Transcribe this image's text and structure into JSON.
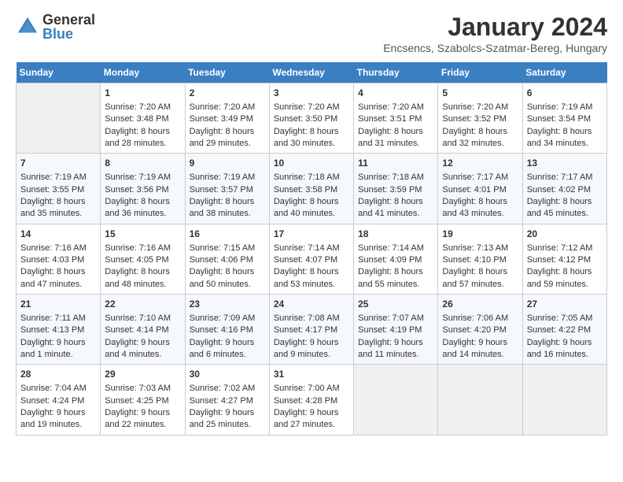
{
  "header": {
    "logo": {
      "general": "General",
      "blue": "Blue"
    },
    "title": "January 2024",
    "location": "Encsencs, Szabolcs-Szatmar-Bereg, Hungary"
  },
  "weekdays": [
    "Sunday",
    "Monday",
    "Tuesday",
    "Wednesday",
    "Thursday",
    "Friday",
    "Saturday"
  ],
  "weeks": [
    [
      {
        "day": "",
        "sunrise": "",
        "sunset": "",
        "daylight": ""
      },
      {
        "day": "1",
        "sunrise": "Sunrise: 7:20 AM",
        "sunset": "Sunset: 3:48 PM",
        "daylight": "Daylight: 8 hours and 28 minutes."
      },
      {
        "day": "2",
        "sunrise": "Sunrise: 7:20 AM",
        "sunset": "Sunset: 3:49 PM",
        "daylight": "Daylight: 8 hours and 29 minutes."
      },
      {
        "day": "3",
        "sunrise": "Sunrise: 7:20 AM",
        "sunset": "Sunset: 3:50 PM",
        "daylight": "Daylight: 8 hours and 30 minutes."
      },
      {
        "day": "4",
        "sunrise": "Sunrise: 7:20 AM",
        "sunset": "Sunset: 3:51 PM",
        "daylight": "Daylight: 8 hours and 31 minutes."
      },
      {
        "day": "5",
        "sunrise": "Sunrise: 7:20 AM",
        "sunset": "Sunset: 3:52 PM",
        "daylight": "Daylight: 8 hours and 32 minutes."
      },
      {
        "day": "6",
        "sunrise": "Sunrise: 7:19 AM",
        "sunset": "Sunset: 3:54 PM",
        "daylight": "Daylight: 8 hours and 34 minutes."
      }
    ],
    [
      {
        "day": "7",
        "sunrise": "Sunrise: 7:19 AM",
        "sunset": "Sunset: 3:55 PM",
        "daylight": "Daylight: 8 hours and 35 minutes."
      },
      {
        "day": "8",
        "sunrise": "Sunrise: 7:19 AM",
        "sunset": "Sunset: 3:56 PM",
        "daylight": "Daylight: 8 hours and 36 minutes."
      },
      {
        "day": "9",
        "sunrise": "Sunrise: 7:19 AM",
        "sunset": "Sunset: 3:57 PM",
        "daylight": "Daylight: 8 hours and 38 minutes."
      },
      {
        "day": "10",
        "sunrise": "Sunrise: 7:18 AM",
        "sunset": "Sunset: 3:58 PM",
        "daylight": "Daylight: 8 hours and 40 minutes."
      },
      {
        "day": "11",
        "sunrise": "Sunrise: 7:18 AM",
        "sunset": "Sunset: 3:59 PM",
        "daylight": "Daylight: 8 hours and 41 minutes."
      },
      {
        "day": "12",
        "sunrise": "Sunrise: 7:17 AM",
        "sunset": "Sunset: 4:01 PM",
        "daylight": "Daylight: 8 hours and 43 minutes."
      },
      {
        "day": "13",
        "sunrise": "Sunrise: 7:17 AM",
        "sunset": "Sunset: 4:02 PM",
        "daylight": "Daylight: 8 hours and 45 minutes."
      }
    ],
    [
      {
        "day": "14",
        "sunrise": "Sunrise: 7:16 AM",
        "sunset": "Sunset: 4:03 PM",
        "daylight": "Daylight: 8 hours and 47 minutes."
      },
      {
        "day": "15",
        "sunrise": "Sunrise: 7:16 AM",
        "sunset": "Sunset: 4:05 PM",
        "daylight": "Daylight: 8 hours and 48 minutes."
      },
      {
        "day": "16",
        "sunrise": "Sunrise: 7:15 AM",
        "sunset": "Sunset: 4:06 PM",
        "daylight": "Daylight: 8 hours and 50 minutes."
      },
      {
        "day": "17",
        "sunrise": "Sunrise: 7:14 AM",
        "sunset": "Sunset: 4:07 PM",
        "daylight": "Daylight: 8 hours and 53 minutes."
      },
      {
        "day": "18",
        "sunrise": "Sunrise: 7:14 AM",
        "sunset": "Sunset: 4:09 PM",
        "daylight": "Daylight: 8 hours and 55 minutes."
      },
      {
        "day": "19",
        "sunrise": "Sunrise: 7:13 AM",
        "sunset": "Sunset: 4:10 PM",
        "daylight": "Daylight: 8 hours and 57 minutes."
      },
      {
        "day": "20",
        "sunrise": "Sunrise: 7:12 AM",
        "sunset": "Sunset: 4:12 PM",
        "daylight": "Daylight: 8 hours and 59 minutes."
      }
    ],
    [
      {
        "day": "21",
        "sunrise": "Sunrise: 7:11 AM",
        "sunset": "Sunset: 4:13 PM",
        "daylight": "Daylight: 9 hours and 1 minute."
      },
      {
        "day": "22",
        "sunrise": "Sunrise: 7:10 AM",
        "sunset": "Sunset: 4:14 PM",
        "daylight": "Daylight: 9 hours and 4 minutes."
      },
      {
        "day": "23",
        "sunrise": "Sunrise: 7:09 AM",
        "sunset": "Sunset: 4:16 PM",
        "daylight": "Daylight: 9 hours and 6 minutes."
      },
      {
        "day": "24",
        "sunrise": "Sunrise: 7:08 AM",
        "sunset": "Sunset: 4:17 PM",
        "daylight": "Daylight: 9 hours and 9 minutes."
      },
      {
        "day": "25",
        "sunrise": "Sunrise: 7:07 AM",
        "sunset": "Sunset: 4:19 PM",
        "daylight": "Daylight: 9 hours and 11 minutes."
      },
      {
        "day": "26",
        "sunrise": "Sunrise: 7:06 AM",
        "sunset": "Sunset: 4:20 PM",
        "daylight": "Daylight: 9 hours and 14 minutes."
      },
      {
        "day": "27",
        "sunrise": "Sunrise: 7:05 AM",
        "sunset": "Sunset: 4:22 PM",
        "daylight": "Daylight: 9 hours and 16 minutes."
      }
    ],
    [
      {
        "day": "28",
        "sunrise": "Sunrise: 7:04 AM",
        "sunset": "Sunset: 4:24 PM",
        "daylight": "Daylight: 9 hours and 19 minutes."
      },
      {
        "day": "29",
        "sunrise": "Sunrise: 7:03 AM",
        "sunset": "Sunset: 4:25 PM",
        "daylight": "Daylight: 9 hours and 22 minutes."
      },
      {
        "day": "30",
        "sunrise": "Sunrise: 7:02 AM",
        "sunset": "Sunset: 4:27 PM",
        "daylight": "Daylight: 9 hours and 25 minutes."
      },
      {
        "day": "31",
        "sunrise": "Sunrise: 7:00 AM",
        "sunset": "Sunset: 4:28 PM",
        "daylight": "Daylight: 9 hours and 27 minutes."
      },
      {
        "day": "",
        "sunrise": "",
        "sunset": "",
        "daylight": ""
      },
      {
        "day": "",
        "sunrise": "",
        "sunset": "",
        "daylight": ""
      },
      {
        "day": "",
        "sunrise": "",
        "sunset": "",
        "daylight": ""
      }
    ]
  ]
}
